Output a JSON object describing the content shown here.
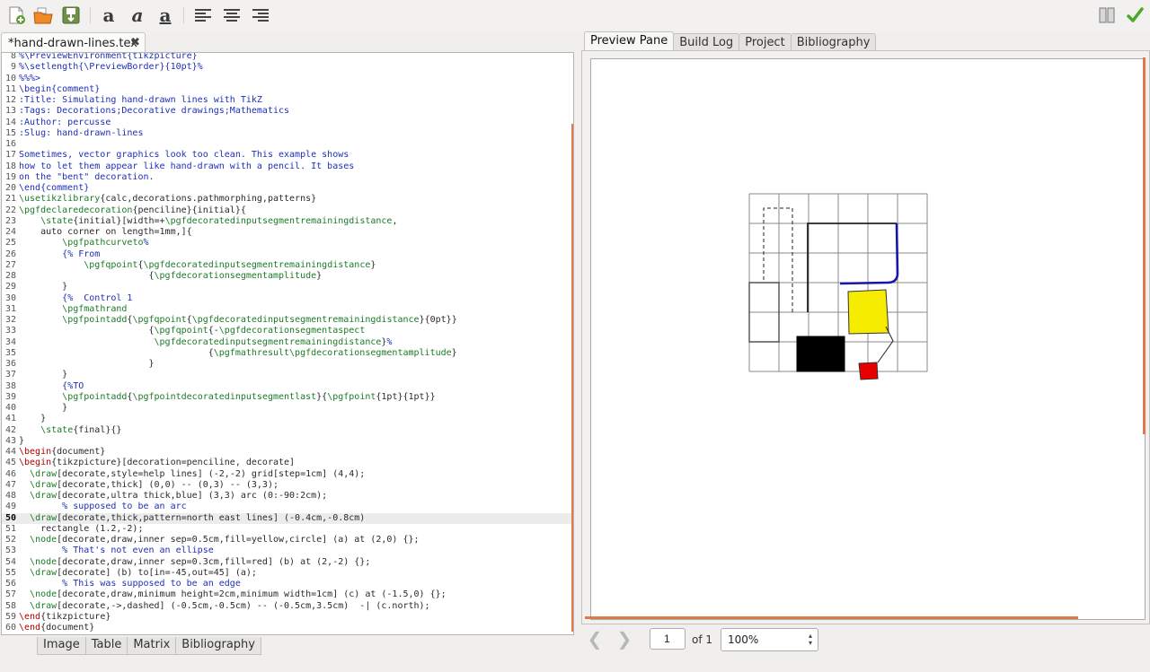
{
  "window": {
    "title": ""
  },
  "toolbar": {
    "buttons": [
      {
        "name": "new-file-icon",
        "label": "New"
      },
      {
        "name": "open-folder-icon",
        "label": "Open"
      },
      {
        "name": "save-icon",
        "label": "Save"
      },
      {
        "name": "bold-icon",
        "glyph": "a"
      },
      {
        "name": "italic-icon",
        "glyph": "a"
      },
      {
        "name": "underline-icon",
        "glyph": "a"
      },
      {
        "name": "align-left-icon"
      },
      {
        "name": "align-center-icon"
      },
      {
        "name": "align-right-icon"
      },
      {
        "name": "split-view-icon"
      },
      {
        "name": "compile-check-icon"
      }
    ],
    "bold_glyph": "a",
    "italic_glyph": "a",
    "underline_glyph": "a"
  },
  "editor": {
    "tab_label": "*hand-drawn-lines.tex",
    "close_glyph": "✖",
    "current_line": 50,
    "lines": [
      {
        "n": 8,
        "segs": [
          [
            "c",
            "%\\PreviewEnvironment{tikzpicture}"
          ]
        ]
      },
      {
        "n": 9,
        "segs": [
          [
            "c",
            "%\\setlength{\\PreviewBorder}{10pt}%"
          ]
        ]
      },
      {
        "n": 10,
        "segs": [
          [
            "c",
            "%%%>"
          ]
        ]
      },
      {
        "n": 11,
        "segs": [
          [
            "c",
            "\\begin{comment}"
          ]
        ]
      },
      {
        "n": 12,
        "segs": [
          [
            "c",
            ":Title: Simulating hand-drawn lines with TikZ"
          ]
        ]
      },
      {
        "n": 13,
        "segs": [
          [
            "c",
            ":Tags: Decorations;Decorative drawings;Mathematics"
          ]
        ]
      },
      {
        "n": 14,
        "segs": [
          [
            "c",
            ":Author: percusse"
          ]
        ]
      },
      {
        "n": 15,
        "segs": [
          [
            "c",
            ":Slug: hand-drawn-lines"
          ]
        ]
      },
      {
        "n": 16,
        "segs": []
      },
      {
        "n": 17,
        "segs": [
          [
            "c",
            "Sometimes, vector graphics look too clean. This example shows"
          ]
        ]
      },
      {
        "n": 18,
        "segs": [
          [
            "c",
            "how to let them appear like hand-drawn with a pencil. It bases"
          ]
        ]
      },
      {
        "n": 19,
        "segs": [
          [
            "c",
            "on the \"bent\" decoration."
          ]
        ]
      },
      {
        "n": 20,
        "segs": [
          [
            "c",
            "\\end{comment}"
          ]
        ]
      },
      {
        "n": 21,
        "segs": [
          [
            "g",
            "\\usetikzlibrary"
          ],
          [
            "k",
            "{calc,decorations.pathmorphing,patterns}"
          ]
        ]
      },
      {
        "n": 22,
        "segs": [
          [
            "g",
            "\\pgfdeclaredecoration"
          ],
          [
            "k",
            "{penciline}{initial}{"
          ]
        ]
      },
      {
        "n": 23,
        "segs": [
          [
            "k",
            "    "
          ],
          [
            "g",
            "\\state"
          ],
          [
            "k",
            "{initial}[width=+"
          ],
          [
            "g",
            "\\pgfdecoratedinputsegmentremainingdistance"
          ],
          [
            "k",
            ","
          ]
        ]
      },
      {
        "n": 24,
        "segs": [
          [
            "k",
            "    auto corner on length=1mm,]{"
          ]
        ]
      },
      {
        "n": 25,
        "segs": [
          [
            "k",
            "        "
          ],
          [
            "g",
            "\\pgfpathcurveto"
          ],
          [
            "c",
            "%"
          ]
        ]
      },
      {
        "n": 26,
        "segs": [
          [
            "k",
            "        "
          ],
          [
            "c",
            "{% From"
          ]
        ]
      },
      {
        "n": 27,
        "segs": [
          [
            "k",
            "            "
          ],
          [
            "g",
            "\\pgfqpoint"
          ],
          [
            "k",
            "{"
          ],
          [
            "g",
            "\\pgfdecoratedinputsegmentremainingdistance"
          ],
          [
            "k",
            "}"
          ]
        ]
      },
      {
        "n": 28,
        "segs": [
          [
            "k",
            "                        {"
          ],
          [
            "g",
            "\\pgfdecorationsegmentamplitude"
          ],
          [
            "k",
            "}"
          ]
        ]
      },
      {
        "n": 29,
        "segs": [
          [
            "k",
            "        }"
          ]
        ]
      },
      {
        "n": 30,
        "segs": [
          [
            "k",
            "        "
          ],
          [
            "c",
            "{%  Control 1"
          ]
        ]
      },
      {
        "n": 31,
        "segs": [
          [
            "k",
            "        "
          ],
          [
            "g",
            "\\pgfmathrand"
          ]
        ]
      },
      {
        "n": 32,
        "segs": [
          [
            "k",
            "        "
          ],
          [
            "g",
            "\\pgfpointadd"
          ],
          [
            "k",
            "{"
          ],
          [
            "g",
            "\\pgfqpoint"
          ],
          [
            "k",
            "{"
          ],
          [
            "g",
            "\\pgfdecoratedinputsegmentremainingdistance"
          ],
          [
            "k",
            "}{0pt}}"
          ]
        ]
      },
      {
        "n": 33,
        "segs": [
          [
            "k",
            "                        {"
          ],
          [
            "g",
            "\\pgfqpoint"
          ],
          [
            "k",
            "{-"
          ],
          [
            "g",
            "\\pgfdecorationsegmentaspect"
          ]
        ]
      },
      {
        "n": 34,
        "segs": [
          [
            "k",
            "                         "
          ],
          [
            "g",
            "\\pgfdecoratedinputsegmentremainingdistance"
          ],
          [
            "k",
            "}"
          ],
          [
            "c",
            "%"
          ]
        ]
      },
      {
        "n": 35,
        "segs": [
          [
            "k",
            "                                   {"
          ],
          [
            "g",
            "\\pgfmathresult\\pgfdecorationsegmentamplitude"
          ],
          [
            "k",
            "}"
          ]
        ]
      },
      {
        "n": 36,
        "segs": [
          [
            "k",
            "                        }"
          ]
        ]
      },
      {
        "n": 37,
        "segs": [
          [
            "k",
            "        }"
          ]
        ]
      },
      {
        "n": 38,
        "segs": [
          [
            "k",
            "        "
          ],
          [
            "c",
            "{%TO"
          ]
        ]
      },
      {
        "n": 39,
        "segs": [
          [
            "k",
            "        "
          ],
          [
            "g",
            "\\pgfpointadd"
          ],
          [
            "k",
            "{"
          ],
          [
            "g",
            "\\pgfpointdecoratedinputsegmentlast"
          ],
          [
            "k",
            "}{"
          ],
          [
            "g",
            "\\pgfpoint"
          ],
          [
            "k",
            "{1pt}{1pt}}"
          ]
        ]
      },
      {
        "n": 40,
        "segs": [
          [
            "k",
            "        }"
          ]
        ]
      },
      {
        "n": 41,
        "segs": [
          [
            "k",
            "    }"
          ]
        ]
      },
      {
        "n": 42,
        "segs": [
          [
            "k",
            "    "
          ],
          [
            "g",
            "\\state"
          ],
          [
            "k",
            "{final}{}"
          ]
        ]
      },
      {
        "n": 43,
        "segs": [
          [
            "k",
            "}"
          ]
        ]
      },
      {
        "n": 44,
        "segs": [
          [
            "r",
            "\\begin"
          ],
          [
            "k",
            "{document}"
          ]
        ]
      },
      {
        "n": 45,
        "segs": [
          [
            "r",
            "\\begin"
          ],
          [
            "k",
            "{tikzpicture}[decoration=penciline, decorate]"
          ]
        ]
      },
      {
        "n": 46,
        "segs": [
          [
            "k",
            "  "
          ],
          [
            "g",
            "\\draw"
          ],
          [
            "k",
            "[decorate,style=help lines] (-2,-2) grid[step=1cm] (4,4);"
          ]
        ]
      },
      {
        "n": 47,
        "segs": [
          [
            "k",
            "  "
          ],
          [
            "g",
            "\\draw"
          ],
          [
            "k",
            "[decorate,thick] (0,0) -- (0,3) -- (3,3);"
          ]
        ]
      },
      {
        "n": 48,
        "segs": [
          [
            "k",
            "  "
          ],
          [
            "g",
            "\\draw"
          ],
          [
            "k",
            "[decorate,ultra thick,blue] (3,3) arc (0:-90:2cm);"
          ]
        ]
      },
      {
        "n": 49,
        "segs": [
          [
            "k",
            "        "
          ],
          [
            "c",
            "% supposed to be an arc"
          ]
        ]
      },
      {
        "n": 50,
        "segs": [
          [
            "k",
            "  "
          ],
          [
            "g",
            "\\draw"
          ],
          [
            "k",
            "[decorate,thick,pattern=north east lines] (-0.4cm,-0.8cm)"
          ]
        ]
      },
      {
        "n": 51,
        "segs": [
          [
            "k",
            "    rectangle (1.2,-2);"
          ]
        ]
      },
      {
        "n": 52,
        "segs": [
          [
            "k",
            "  "
          ],
          [
            "g",
            "\\node"
          ],
          [
            "k",
            "[decorate,draw,inner sep=0.5cm,fill=yellow,circle] (a) at (2,0) {};"
          ]
        ]
      },
      {
        "n": 53,
        "segs": [
          [
            "k",
            "        "
          ],
          [
            "c",
            "% That's not even an ellipse"
          ]
        ]
      },
      {
        "n": 54,
        "segs": [
          [
            "k",
            "  "
          ],
          [
            "g",
            "\\node"
          ],
          [
            "k",
            "[decorate,draw,inner sep=0.3cm,fill=red] (b) at (2,-2) {};"
          ]
        ]
      },
      {
        "n": 55,
        "segs": [
          [
            "k",
            "  "
          ],
          [
            "g",
            "\\draw"
          ],
          [
            "k",
            "[decorate] (b) to[in=-45,out=45] (a);"
          ]
        ]
      },
      {
        "n": 56,
        "segs": [
          [
            "k",
            "        "
          ],
          [
            "c",
            "% This was supposed to be an edge"
          ]
        ]
      },
      {
        "n": 57,
        "segs": [
          [
            "k",
            "  "
          ],
          [
            "g",
            "\\node"
          ],
          [
            "k",
            "[decorate,draw,minimum height=2cm,minimum width=1cm] (c) at (-1.5,0) {};"
          ]
        ]
      },
      {
        "n": 58,
        "segs": [
          [
            "k",
            "  "
          ],
          [
            "g",
            "\\draw"
          ],
          [
            "k",
            "[decorate,->,dashed] (-0.5cm,-0.5cm) -- (-0.5cm,3.5cm)  -| (c.north);"
          ]
        ]
      },
      {
        "n": 59,
        "segs": [
          [
            "r",
            "\\end"
          ],
          [
            "k",
            "{tikzpicture}"
          ]
        ]
      },
      {
        "n": 60,
        "segs": [
          [
            "r",
            "\\end"
          ],
          [
            "k",
            "{document}"
          ]
        ]
      }
    ]
  },
  "bottom_tabs": [
    {
      "id": "image",
      "label": "Image"
    },
    {
      "id": "table",
      "label": "Table"
    },
    {
      "id": "matrix",
      "label": "Matrix"
    },
    {
      "id": "bibliography",
      "label": "Bibliography"
    }
  ],
  "right_tabs": [
    {
      "id": "preview",
      "label": "Preview Pane",
      "active": true
    },
    {
      "id": "build-log",
      "label": "Build Log",
      "active": false
    },
    {
      "id": "project",
      "label": "Project",
      "active": false
    },
    {
      "id": "bibliography",
      "label": "Bibliography",
      "active": false
    }
  ],
  "preview": {
    "page_value": "1",
    "page_of": "of 1",
    "zoom": "100%",
    "prev_glyph": "❮",
    "next_glyph": "❯",
    "zoom_arrows": "▴▾"
  },
  "colors": {
    "accent": "#e07a4a",
    "comment": "#1f2fb7",
    "command": "#1c7a26",
    "environment": "#b10000",
    "figure_blue": "#1515b0",
    "figure_yellow": "#f5ec00",
    "figure_red": "#e60000"
  }
}
